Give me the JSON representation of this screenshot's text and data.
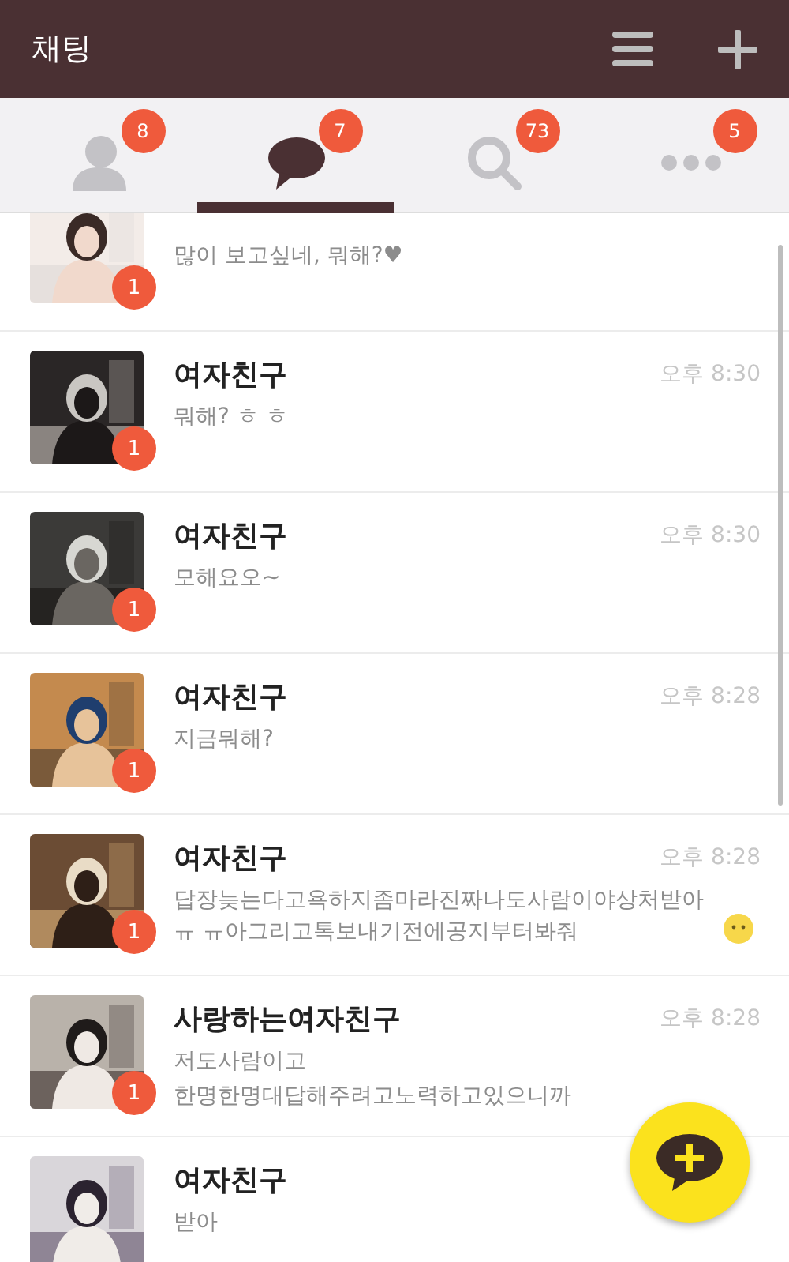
{
  "header": {
    "title": "채팅"
  },
  "tabs": [
    {
      "kind": "friends",
      "badge": "8",
      "selected": false
    },
    {
      "kind": "chats",
      "badge": "7",
      "selected": true
    },
    {
      "kind": "search",
      "badge": "73",
      "selected": false
    },
    {
      "kind": "more",
      "badge": "5",
      "selected": false
    }
  ],
  "chats": [
    {
      "lines": [
        "많이 보고싶네, 뭐해?♥"
      ],
      "unread": "1",
      "partial": true
    },
    {
      "name": "여자친구",
      "time": "오후 8:30",
      "lines": [
        "뭐해? ㅎ ㅎ"
      ],
      "unread": "1"
    },
    {
      "name": "여자친구",
      "time": "오후 8:30",
      "lines": [
        "모해요오~"
      ],
      "unread": "1"
    },
    {
      "name": "여자친구",
      "time": "오후 8:28",
      "lines": [
        "지금뭐해?"
      ],
      "unread": "1"
    },
    {
      "name": "여자친구",
      "time": "오후 8:28",
      "lines": [
        "답장늦는다고욕하지좀마라진짜나도사람이야상처받아ㅠ ㅠ아그리고톡보내기전에공지부터봐줘"
      ],
      "emoji": true,
      "unread": "1"
    },
    {
      "name": "사랑하는여자친구",
      "time": "오후 8:28",
      "lines": [
        "저도사람이고",
        "한명한명대답해주려고노력하고있으니까"
      ],
      "unread": "1"
    },
    {
      "name": "여자친구",
      "lines": [
        "받아"
      ]
    }
  ]
}
